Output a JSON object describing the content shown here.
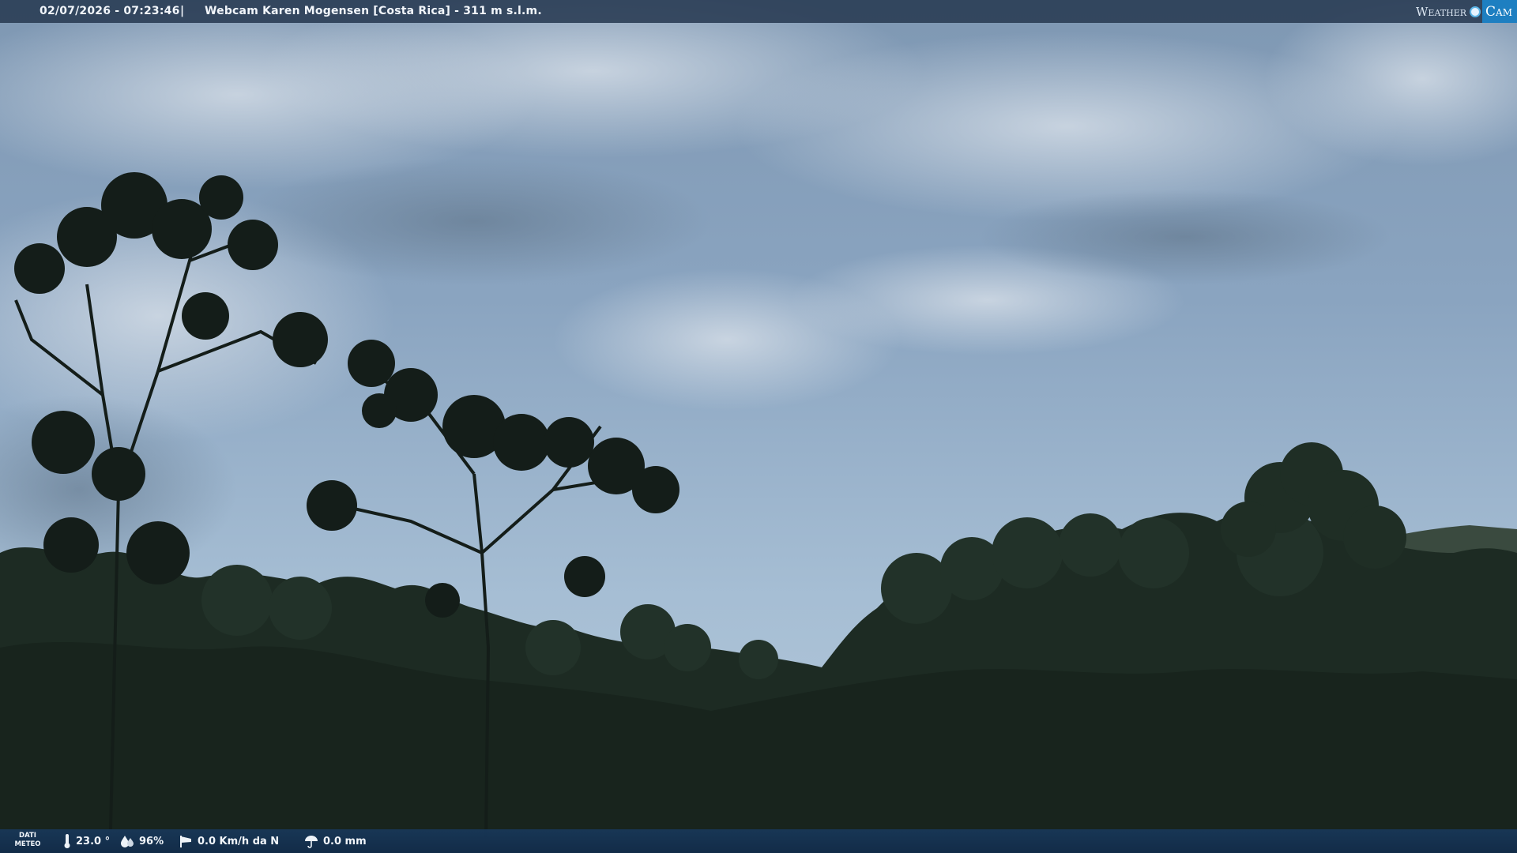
{
  "header": {
    "datetime": "02/07/2026 - 07:23:46",
    "separator": "|",
    "title": "Webcam Karen Mogensen [Costa Rica]  - 311 m s.l.m."
  },
  "logo": {
    "weather_text": "Weather",
    "cam_text": "Cam"
  },
  "footer": {
    "dati_line1": "DATI",
    "dati_line2": "METEO",
    "temperature": "23.0 °",
    "humidity": "96%",
    "wind": "0.0 Km/h da N",
    "rain": "0.0 mm",
    "icons": {
      "temperature": "thermometer-icon",
      "humidity": "humidity-drops-icon",
      "wind": "windsock-icon",
      "rain": "umbrella-icon"
    }
  },
  "colors": {
    "sky_top": "#8da4bd",
    "sky_bottom": "#aec3d8",
    "forest": "#1b2a22",
    "bar": "#283a52",
    "logo_blue": "#1e7fc1"
  }
}
